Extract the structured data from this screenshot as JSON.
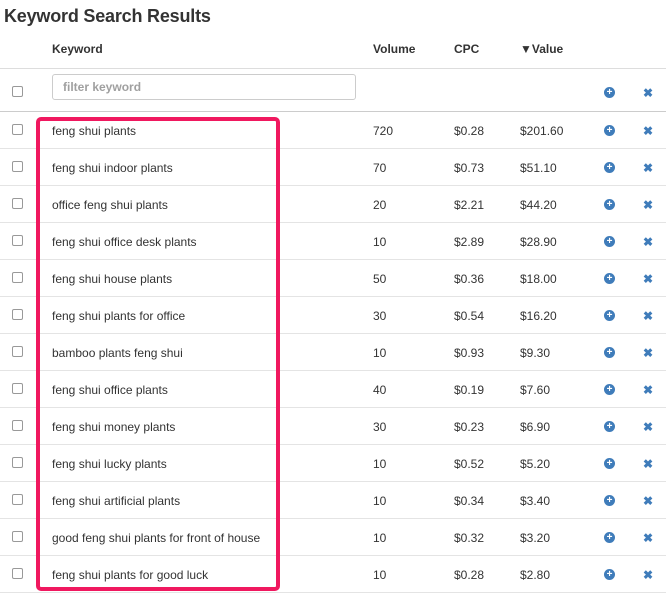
{
  "page": {
    "title": "Keyword Search Results"
  },
  "table": {
    "columns": {
      "keyword": "Keyword",
      "volume": "Volume",
      "cpc": "CPC",
      "value": "▼Value"
    },
    "filter_placeholder": "filter keyword",
    "rows": [
      {
        "keyword": "feng shui plants",
        "volume": "720",
        "cpc": "$0.28",
        "value": "$201.60"
      },
      {
        "keyword": "feng shui indoor plants",
        "volume": "70",
        "cpc": "$0.73",
        "value": "$51.10"
      },
      {
        "keyword": "office feng shui plants",
        "volume": "20",
        "cpc": "$2.21",
        "value": "$44.20"
      },
      {
        "keyword": "feng shui office desk plants",
        "volume": "10",
        "cpc": "$2.89",
        "value": "$28.90"
      },
      {
        "keyword": "feng shui house plants",
        "volume": "50",
        "cpc": "$0.36",
        "value": "$18.00"
      },
      {
        "keyword": "feng shui plants for office",
        "volume": "30",
        "cpc": "$0.54",
        "value": "$16.20"
      },
      {
        "keyword": "bamboo plants feng shui",
        "volume": "10",
        "cpc": "$0.93",
        "value": "$9.30"
      },
      {
        "keyword": "feng shui office plants",
        "volume": "40",
        "cpc": "$0.19",
        "value": "$7.60"
      },
      {
        "keyword": "feng shui money plants",
        "volume": "30",
        "cpc": "$0.23",
        "value": "$6.90"
      },
      {
        "keyword": "feng shui lucky plants",
        "volume": "10",
        "cpc": "$0.52",
        "value": "$5.20"
      },
      {
        "keyword": "feng shui artificial plants",
        "volume": "10",
        "cpc": "$0.34",
        "value": "$3.40"
      },
      {
        "keyword": "good feng shui plants for front of house",
        "volume": "10",
        "cpc": "$0.32",
        "value": "$3.20"
      },
      {
        "keyword": "feng shui plants for good luck",
        "volume": "10",
        "cpc": "$0.28",
        "value": "$2.80"
      }
    ]
  },
  "icons": {
    "add": "plus-circle-icon",
    "remove": "close-x-icon",
    "sort": "sort-desc-icon"
  },
  "colors": {
    "accent": "#3f7cba",
    "highlight": "#f0185f"
  }
}
